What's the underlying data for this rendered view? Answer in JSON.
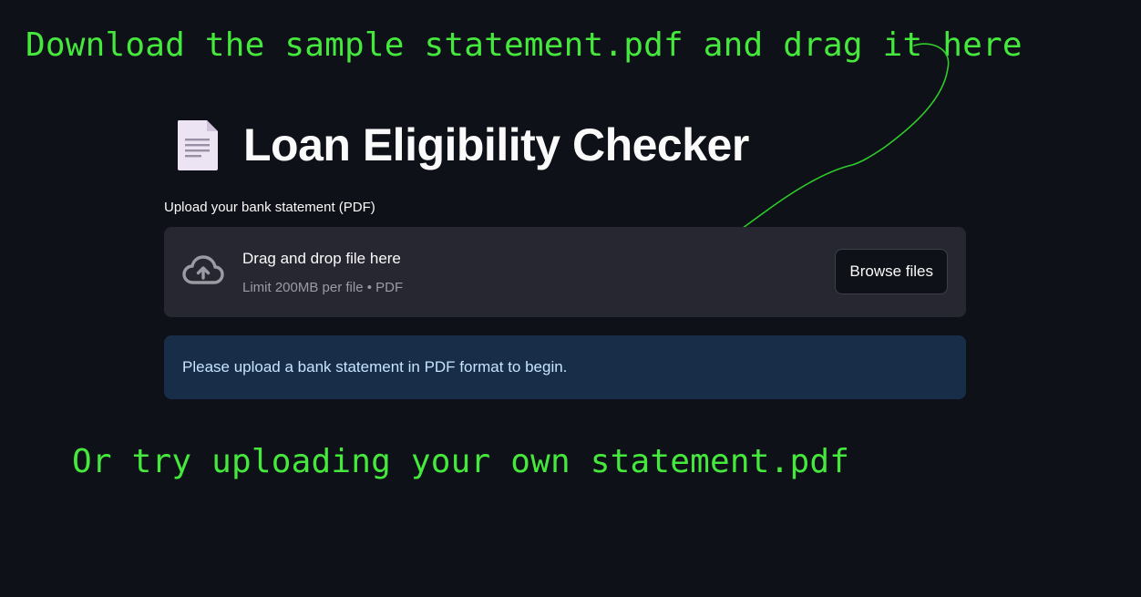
{
  "annotations": {
    "top_hint": "Download the sample statement.pdf and drag it here",
    "bottom_hint": "Or try uploading your own statement.pdf",
    "color": "#45e83c"
  },
  "header": {
    "icon": "document-icon",
    "title": "Loan Eligibility Checker"
  },
  "uploader": {
    "label": "Upload your bank statement (PDF)",
    "icon": "cloud-upload-icon",
    "drop_text": "Drag and drop file here",
    "limit_text": "Limit 200MB per file • PDF",
    "browse_label": "Browse files"
  },
  "info": {
    "message": "Please upload a bank statement in PDF format to begin."
  },
  "colors": {
    "background": "#0e1117",
    "dropzone": "#262730",
    "info_background": "#172d48",
    "info_text": "#c7e4ff"
  }
}
